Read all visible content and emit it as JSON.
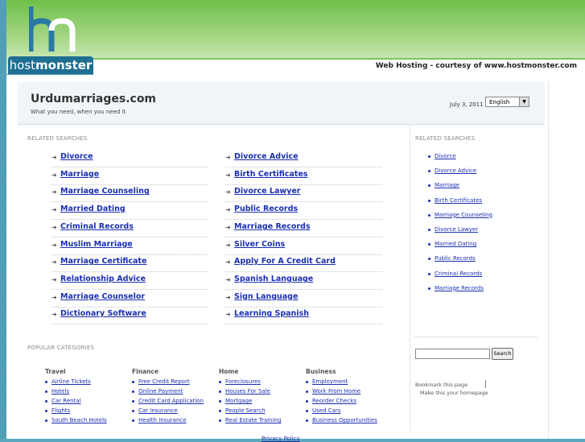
{
  "hosting": {
    "logo_part1": "host",
    "logo_part2": "monster",
    "banner": "Web Hosting - courtesy of www.hostmonster.com"
  },
  "site": {
    "title": "Urdumarriages.com",
    "tagline": "What you need, when you need it",
    "date": "July 3, 2011",
    "language": "English"
  },
  "related_head": "RELATED SEARCHES",
  "related_left": [
    "Divorce",
    "Marriage",
    "Marriage Counseling",
    "Married Dating",
    "Criminal Records",
    "Muslim Marriage",
    "Marriage Certificate",
    "Relationship Advice",
    "Marriage Counselor",
    "Dictionary Software"
  ],
  "related_right": [
    "Divorce Advice",
    "Birth Certificates",
    "Divorce Lawyer",
    "Public Records",
    "Marriage Records",
    "Silver Coins",
    "Apply For A Credit Card",
    "Spanish Language",
    "Sign Language",
    "Learning Spanish"
  ],
  "side_head": "RELATED SEARCHES",
  "side_list": [
    "Divorce",
    "Divorce Advice",
    "Marriage",
    "Birth Certificates",
    "Marriage Counseling",
    "Divorce Lawyer",
    "Married Dating",
    "Public Records",
    "Criminal Records",
    "Marriage Records"
  ],
  "popular_head": "POPULAR CATEGORIES",
  "popular": [
    {
      "title": "Travel",
      "items": [
        "Airline Tickets",
        "Hotels",
        "Car Rental",
        "Flights",
        "South Beach Hotels"
      ]
    },
    {
      "title": "Finance",
      "items": [
        "Free Credit Report",
        "Online Payment",
        "Credit Card Application",
        "Car Insurance",
        "Health Insurance"
      ]
    },
    {
      "title": "Home",
      "items": [
        "Foreclosures",
        "Houses For Sale",
        "Mortgage",
        "People Search",
        "Real Estate Training"
      ]
    },
    {
      "title": "Business",
      "items": [
        "Employment",
        "Work From Home",
        "Reorder Checks",
        "Used Cars",
        "Business Opportunities"
      ]
    }
  ],
  "search_button": "Search",
  "bookmark": "Bookmark this page",
  "homepage": "Make this your homepage",
  "privacy": "Privacy Policy",
  "icons": {
    "arrow": "right-arrow-icon",
    "bullet": "bullet-icon",
    "dropdown": "chevron-down-icon"
  },
  "colors": {
    "link": "#1a2fb0",
    "green": "#6fc04a",
    "logo_blue": "#1f6f93"
  }
}
